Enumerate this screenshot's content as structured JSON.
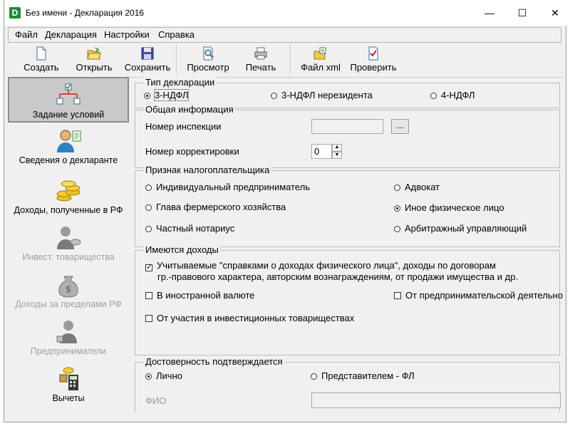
{
  "window": {
    "app_icon_letter": "D",
    "title": "Без имени - Декларация 2016",
    "minimize": "—",
    "maximize": "☐",
    "close": "✕"
  },
  "menu": [
    "Файл",
    "Декларация",
    "Настройки",
    "Справка"
  ],
  "toolbar": {
    "create": "Создать",
    "open": "Открыть",
    "save": "Сохранить",
    "preview": "Просмотр",
    "print": "Печать",
    "xml": "Файл xml",
    "check": "Проверить"
  },
  "sidebar": [
    {
      "label": "Задание условий",
      "state": "selected",
      "icon": "tree-checklist-icon"
    },
    {
      "label": "Сведения о декларанте",
      "state": "enabled",
      "icon": "person-document-icon"
    },
    {
      "label": "Доходы, полученные в РФ",
      "state": "enabled",
      "icon": "coins-icon"
    },
    {
      "label": "Инвест. товарищества",
      "state": "disabled",
      "icon": "investor-icon"
    },
    {
      "label": "Доходы за пределами РФ",
      "state": "disabled",
      "icon": "money-bag-icon"
    },
    {
      "label": "Предприниматели",
      "state": "disabled",
      "icon": "entrepreneur-icon"
    },
    {
      "label": "Вычеты",
      "state": "enabled",
      "icon": "calculator-icon"
    }
  ],
  "declaration_type": {
    "title": "Тип декларации",
    "options": [
      "3-НДФЛ",
      "3-НДФЛ нерезидента",
      "4-НДФЛ"
    ],
    "selected": "3-НДФЛ"
  },
  "general_info": {
    "title": "Общая информация",
    "inspection_label": "Номер инспекции",
    "inspection_value": "",
    "browse_button": "...",
    "correction_label": "Номер корректировки",
    "correction_value": "0"
  },
  "taxpayer": {
    "title": "Признак налогоплательщика",
    "options": [
      "Индивидуальный предприниматель",
      "Адвокат",
      "Глава фермерского хозяйства",
      "Иное физическое лицо",
      "Частный нотариус",
      "Арбитражный управляющий"
    ],
    "selected": "Иное физическое лицо"
  },
  "income": {
    "title": "Имеются доходы",
    "cert_line1": "Учитываемые \"справками о доходах физического лица\", доходы по договорам",
    "cert_line2": "гр.-правового характера, авторским вознаграждениям, от продажи имущества и др.",
    "cert_checked": true,
    "foreign_currency": "В иностранной валюте",
    "foreign_checked": false,
    "entrepreneur": "От предпринимательской деятельно",
    "entrepreneur_checked": false,
    "investment": "От участия в инвестиционных товариществах",
    "investment_checked": false
  },
  "reliability": {
    "title": "Достоверность подтверждается",
    "options": [
      "Лично",
      "Представителем - ФЛ"
    ],
    "selected": "Лично",
    "fio_label": "ФИО",
    "fio_value": ""
  }
}
